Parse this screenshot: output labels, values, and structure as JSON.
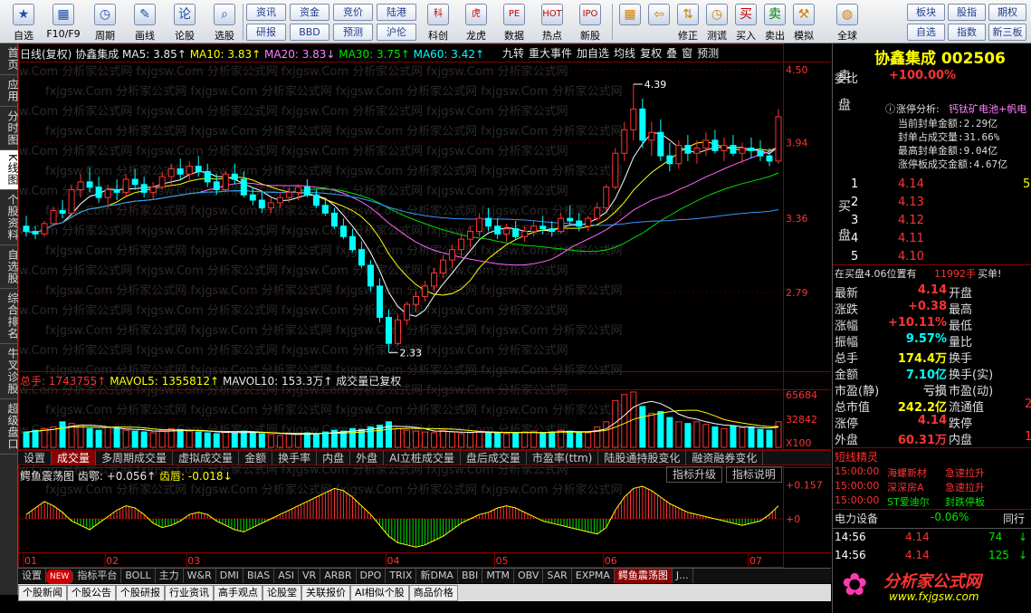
{
  "toolbar": {
    "buttons": [
      {
        "label": "自选",
        "icon": "star-icon",
        "glyph": "★"
      },
      {
        "label": "F10/F9",
        "icon": "table-icon",
        "glyph": "▦"
      },
      {
        "label": "周期",
        "icon": "clock-icon",
        "glyph": "◷"
      },
      {
        "label": "画线",
        "icon": "pencil-icon",
        "glyph": "✎"
      },
      {
        "label": "论股",
        "icon": "discuss-icon",
        "glyph": "论"
      },
      {
        "label": "选股",
        "icon": "search-chart-icon",
        "glyph": "⌕"
      }
    ],
    "small_buttons": [
      "资讯",
      "资金",
      "竞价",
      "陆港",
      "研报",
      "BBD",
      "预测",
      "沪伦"
    ],
    "mid_buttons": [
      {
        "label": "科创",
        "glyph": "科"
      },
      {
        "label": "龙虎",
        "glyph": "虎"
      },
      {
        "label": "数据",
        "glyph": "PE"
      },
      {
        "label": "热点",
        "glyph": "HOT"
      },
      {
        "label": "新股",
        "glyph": "IPO"
      }
    ],
    "right_buttons": [
      {
        "label": "",
        "glyph": "▦"
      },
      {
        "label": "",
        "glyph": "⇦"
      },
      {
        "label": "修正",
        "glyph": "⇅"
      },
      {
        "label": "测谎",
        "glyph": "◷"
      },
      {
        "label": "买入",
        "glyph": "买"
      },
      {
        "label": "卖出",
        "glyph": "卖"
      },
      {
        "label": "模拟",
        "glyph": "⚒"
      },
      {
        "label": "全球",
        "glyph": "◍"
      }
    ],
    "far_right": [
      "板块",
      "股指",
      "期权",
      "自选",
      "指数",
      "新三板"
    ]
  },
  "left_tabs": [
    "首页",
    "应用",
    "分时图",
    "K线图",
    "个股资料",
    "自选股",
    "综合排名",
    "牛叉诊股",
    "超级盘口"
  ],
  "chart_header": {
    "period": "日线(复权)",
    "stock_name": "协鑫集成",
    "ma5": "MA5: 3.85↑",
    "ma10": "MA10: 3.83↑",
    "ma20": "MA20: 3.83↓",
    "ma30": "MA30: 3.75↑",
    "ma60": "MA60: 3.42↑",
    "right_tabs": [
      "九转",
      "重大事件",
      "加自选",
      "均线",
      "复权",
      "叠",
      "窗",
      "预测"
    ]
  },
  "price_axis": [
    "4.50",
    "3.94",
    "3.36",
    "2.79"
  ],
  "annotations": {
    "high": "4.39",
    "low": "2.33"
  },
  "vol_header": {
    "total": "总手: 1743755↑",
    "mavol5": "MAVOL5: 1355812↑",
    "mavol10": "MAVOL10: 153.3万↑",
    "note": "成交量已复权"
  },
  "vol_axis": [
    "65684",
    "32842",
    "X100"
  ],
  "vol_tabs": [
    "设置",
    "成交量",
    "多周期成交量",
    "虚拟成交量",
    "金额",
    "换手率",
    "内盘",
    "外盘",
    "AI立桩成交量",
    "盘后成交量",
    "市盈率(ttm)",
    "陆股通持股变化",
    "融资融券变化"
  ],
  "ind_header": {
    "name": "鳄鱼震荡图",
    "jaw_lbl": "齿鄂: ",
    "jaw_val": "+0.056↑",
    "lip_lbl": "齿唇: ",
    "lip_val": "-0.018↓",
    "btn1": "指标升级",
    "btn2": "指标说明"
  },
  "ind_axis": [
    "+0.157",
    "+0"
  ],
  "months": [
    "01",
    "02",
    "03",
    "04",
    "05",
    "06",
    "07"
  ],
  "bottom_tabs": [
    "设置",
    "NEW",
    "指标平台",
    "BOLL",
    "主力",
    "W&R",
    "DMI",
    "BIAS",
    "ASI",
    "VR",
    "ARBR",
    "DPO",
    "TRIX",
    "新DMA",
    "BBI",
    "MTM",
    "OBV",
    "SAR",
    "EXPMA",
    "鳄鱼震荡图",
    "J..."
  ],
  "news_tabs": [
    "个股新闻",
    "个股公告",
    "个股研报",
    "行业资讯",
    "高手观点",
    "论股堂",
    "关联报价",
    "AI相似个股",
    "商品价格"
  ],
  "watermark": "fxjgsw.Com 分析家公式网",
  "right": {
    "title": "协鑫集成 002506",
    "weibi_label": "委比",
    "weibi_value": "+100.00%",
    "limit_title": "涨停分析:",
    "limit_tags": "钙钛矿电池+帆电",
    "limit_lines": [
      "当前封单金额:2.29亿",
      "封单占成交量:31.66%",
      "最高封单金额:9.04亿",
      "涨停板成交金额:4.67亿"
    ],
    "sell_label": "卖盘",
    "buy_label": "买盘",
    "bids": [
      {
        "n": "1",
        "price": "4.14",
        "vol": "5"
      },
      {
        "n": "2",
        "price": "4.13",
        "vol": ""
      },
      {
        "n": "3",
        "price": "4.12",
        "vol": ""
      },
      {
        "n": "4",
        "price": "4.11",
        "vol": ""
      },
      {
        "n": "5",
        "price": "4.10",
        "vol": ""
      }
    ],
    "queue_text": "在买盘4.06位置有",
    "queue_vol": "11992手",
    "queue_tail": "买单!",
    "stats": [
      {
        "l": "最新",
        "v": "4.14",
        "c": "red",
        "l2": "开盘",
        "v2": ""
      },
      {
        "l": "涨跌",
        "v": "+0.38",
        "c": "red",
        "l2": "最高",
        "v2": ""
      },
      {
        "l": "涨幅",
        "v": "+10.11%",
        "c": "red",
        "l2": "最低",
        "v2": ""
      },
      {
        "l": "振幅",
        "v": "9.57%",
        "c": "cy",
        "l2": "量比",
        "v2": ""
      },
      {
        "l": "总手",
        "v": "174.4万",
        "c": "yel",
        "l2": "换手",
        "v2": ""
      },
      {
        "l": "金额",
        "v": "7.10亿",
        "c": "cy",
        "l2": "换手(实)",
        "v2": ""
      },
      {
        "l": "市盈(静)",
        "v": "亏损",
        "c": "gry",
        "l2": "市盈(动)",
        "v2": ""
      },
      {
        "l": "总市值",
        "v": "242.2亿",
        "c": "yel",
        "l2": "流通值",
        "v2": "2"
      },
      {
        "l": "涨停",
        "v": "4.14",
        "c": "red",
        "l2": "跌停",
        "v2": ""
      },
      {
        "l": "外盘",
        "v": "60.31万",
        "c": "red",
        "l2": "内盘",
        "v2": "1"
      }
    ],
    "short_title": "短线精灵",
    "short_rows": [
      {
        "t": "15:00:00",
        "s": "海螺新材",
        "e": "急速拉升"
      },
      {
        "t": "15:00:00",
        "s": "深深房A",
        "e": "急速拉升"
      },
      {
        "t": "15:00:00",
        "s": "ST爱迪尔",
        "e": "封跌停板"
      }
    ],
    "sector_name": "电力设备",
    "sector_pct": "-0.06%",
    "sector_next": "同行",
    "ticks": [
      {
        "t": "14:56",
        "p": "4.14",
        "v": "74",
        "d": "↓"
      },
      {
        "t": "14:56",
        "p": "4.14",
        "v": "125",
        "d": "↓"
      }
    ],
    "logo_text": "分析家公式网",
    "logo_url": "www.fxjgsw.com"
  },
  "chart_data": {
    "type": "candlestick",
    "title": "日线(复权)",
    "x_months": [
      "01",
      "02",
      "03",
      "04",
      "05",
      "06",
      "07"
    ],
    "y_range": [
      2.2,
      4.55
    ],
    "ohlc": [
      [
        3.3,
        3.38,
        3.22,
        3.26
      ],
      [
        3.26,
        3.3,
        3.2,
        3.24
      ],
      [
        3.24,
        3.34,
        3.22,
        3.32
      ],
      [
        3.32,
        3.45,
        3.3,
        3.42
      ],
      [
        3.42,
        3.5,
        3.36,
        3.4
      ],
      [
        3.4,
        3.62,
        3.38,
        3.58
      ],
      [
        3.58,
        3.7,
        3.52,
        3.64
      ],
      [
        3.64,
        3.75,
        3.56,
        3.6
      ],
      [
        3.6,
        3.68,
        3.48,
        3.52
      ],
      [
        3.52,
        3.62,
        3.44,
        3.58
      ],
      [
        3.58,
        3.66,
        3.5,
        3.56
      ],
      [
        3.56,
        3.7,
        3.52,
        3.66
      ],
      [
        3.66,
        3.74,
        3.58,
        3.62
      ],
      [
        3.62,
        3.68,
        3.52,
        3.56
      ],
      [
        3.56,
        3.64,
        3.5,
        3.6
      ],
      [
        3.6,
        3.72,
        3.58,
        3.68
      ],
      [
        3.68,
        3.78,
        3.62,
        3.74
      ],
      [
        3.74,
        3.82,
        3.66,
        3.7
      ],
      [
        3.7,
        3.8,
        3.64,
        3.76
      ],
      [
        3.76,
        3.84,
        3.68,
        3.72
      ],
      [
        3.72,
        3.78,
        3.6,
        3.64
      ],
      [
        3.64,
        3.7,
        3.54,
        3.58
      ],
      [
        3.58,
        3.72,
        3.56,
        3.7
      ],
      [
        3.7,
        3.78,
        3.62,
        3.66
      ],
      [
        3.66,
        3.72,
        3.52,
        3.54
      ],
      [
        3.54,
        3.6,
        3.46,
        3.5
      ],
      [
        3.5,
        3.56,
        3.4,
        3.44
      ],
      [
        3.44,
        3.52,
        3.4,
        3.48
      ],
      [
        3.48,
        3.56,
        3.44,
        3.52
      ],
      [
        3.52,
        3.6,
        3.48,
        3.56
      ],
      [
        3.56,
        3.62,
        3.5,
        3.6
      ],
      [
        3.6,
        3.66,
        3.52,
        3.54
      ],
      [
        3.54,
        3.58,
        3.44,
        3.46
      ],
      [
        3.46,
        3.52,
        3.38,
        3.4
      ],
      [
        3.4,
        3.44,
        3.28,
        3.3
      ],
      [
        3.3,
        3.36,
        3.2,
        3.22
      ],
      [
        3.22,
        3.28,
        3.1,
        3.12
      ],
      [
        3.12,
        3.18,
        2.98,
        3.0
      ],
      [
        3.0,
        3.04,
        2.8,
        2.84
      ],
      [
        2.84,
        2.9,
        2.56,
        2.6
      ],
      [
        2.6,
        2.66,
        2.33,
        2.4
      ],
      [
        2.4,
        2.62,
        2.38,
        2.58
      ],
      [
        2.58,
        2.72,
        2.54,
        2.7
      ],
      [
        2.7,
        2.8,
        2.64,
        2.76
      ],
      [
        2.76,
        2.88,
        2.72,
        2.84
      ],
      [
        2.84,
        2.98,
        2.8,
        2.94
      ],
      [
        2.94,
        3.08,
        2.9,
        3.04
      ],
      [
        3.04,
        3.16,
        2.98,
        3.12
      ],
      [
        3.12,
        3.24,
        3.06,
        3.2
      ],
      [
        3.2,
        3.3,
        3.14,
        3.26
      ],
      [
        3.26,
        3.4,
        3.22,
        3.36
      ],
      [
        3.36,
        3.44,
        3.26,
        3.3
      ],
      [
        3.3,
        3.36,
        3.2,
        3.24
      ],
      [
        3.24,
        3.32,
        3.18,
        3.28
      ],
      [
        3.28,
        3.34,
        3.2,
        3.22
      ],
      [
        3.22,
        3.3,
        3.18,
        3.26
      ],
      [
        3.26,
        3.34,
        3.22,
        3.3
      ],
      [
        3.3,
        3.38,
        3.24,
        3.28
      ],
      [
        3.28,
        3.34,
        3.22,
        3.26
      ],
      [
        3.26,
        3.4,
        3.24,
        3.36
      ],
      [
        3.36,
        3.46,
        3.3,
        3.34
      ],
      [
        3.34,
        3.4,
        3.26,
        3.3
      ],
      [
        3.3,
        3.38,
        3.26,
        3.36
      ],
      [
        3.36,
        3.48,
        3.34,
        3.44
      ],
      [
        3.44,
        3.62,
        3.42,
        3.6
      ],
      [
        3.6,
        3.9,
        3.58,
        3.86
      ],
      [
        3.86,
        4.1,
        3.8,
        4.04
      ],
      [
        4.04,
        4.39,
        3.96,
        4.2
      ],
      [
        4.2,
        4.28,
        3.9,
        3.96
      ],
      [
        3.96,
        4.1,
        3.84,
        4.02
      ],
      [
        4.02,
        4.12,
        3.8,
        3.84
      ],
      [
        3.84,
        3.94,
        3.72,
        3.78
      ],
      [
        3.78,
        3.96,
        3.74,
        3.92
      ],
      [
        3.92,
        4.0,
        3.8,
        3.86
      ],
      [
        3.86,
        3.96,
        3.78,
        3.9
      ],
      [
        3.9,
        4.02,
        3.84,
        3.96
      ],
      [
        3.96,
        4.04,
        3.86,
        3.88
      ],
      [
        3.88,
        3.98,
        3.8,
        3.92
      ],
      [
        3.92,
        4.0,
        3.84,
        3.86
      ],
      [
        3.86,
        3.94,
        3.78,
        3.9
      ],
      [
        3.9,
        3.98,
        3.82,
        3.88
      ],
      [
        3.88,
        3.96,
        3.8,
        3.84
      ],
      [
        3.84,
        3.9,
        3.76,
        3.8
      ],
      [
        3.8,
        4.2,
        3.78,
        4.14
      ]
    ],
    "volume": [
      18,
      20,
      22,
      24,
      30,
      28,
      26,
      22,
      20,
      24,
      22,
      20,
      19,
      18,
      17,
      20,
      22,
      21,
      19,
      18,
      17,
      16,
      18,
      17,
      19,
      18,
      16,
      15,
      14,
      16,
      15,
      17,
      16,
      18,
      20,
      19,
      22,
      21,
      24,
      26,
      30,
      22,
      20,
      19,
      18,
      17,
      20,
      18,
      16,
      17,
      19,
      18,
      17,
      16,
      17,
      18,
      19,
      17,
      18,
      20,
      19,
      18,
      17,
      24,
      30,
      55,
      62,
      65,
      48,
      40,
      42,
      35,
      30,
      28,
      30,
      27,
      24,
      22,
      25,
      23,
      24,
      21,
      20,
      30
    ],
    "oscillator": [
      0.02,
      0.05,
      0.08,
      0.06,
      0.03,
      -0.01,
      -0.03,
      -0.05,
      -0.02,
      0.01,
      0.04,
      0.06,
      0.05,
      0.02,
      -0.02,
      -0.04,
      -0.03,
      -0.01,
      0.02,
      0.03,
      0.02,
      -0.01,
      -0.03,
      -0.05,
      -0.06,
      -0.04,
      -0.02,
      0.0,
      0.02,
      0.04,
      0.06,
      0.08,
      0.1,
      0.12,
      0.14,
      0.13,
      0.1,
      0.06,
      0.02,
      -0.03,
      -0.08,
      -0.11,
      -0.12,
      -0.13,
      -0.12,
      -0.1,
      -0.08,
      -0.05,
      -0.02,
      0.0,
      0.02,
      0.03,
      0.05,
      0.06,
      0.05,
      0.03,
      0.01,
      -0.01,
      -0.02,
      -0.03,
      -0.04,
      -0.05,
      -0.06,
      -0.07,
      -0.04,
      0.04,
      0.1,
      0.14,
      0.15,
      0.13,
      0.1,
      0.07,
      0.05,
      0.03,
      0.02,
      0.01,
      0.0,
      -0.01,
      -0.02,
      -0.03,
      -0.02,
      -0.01,
      0.02,
      0.06
    ]
  }
}
